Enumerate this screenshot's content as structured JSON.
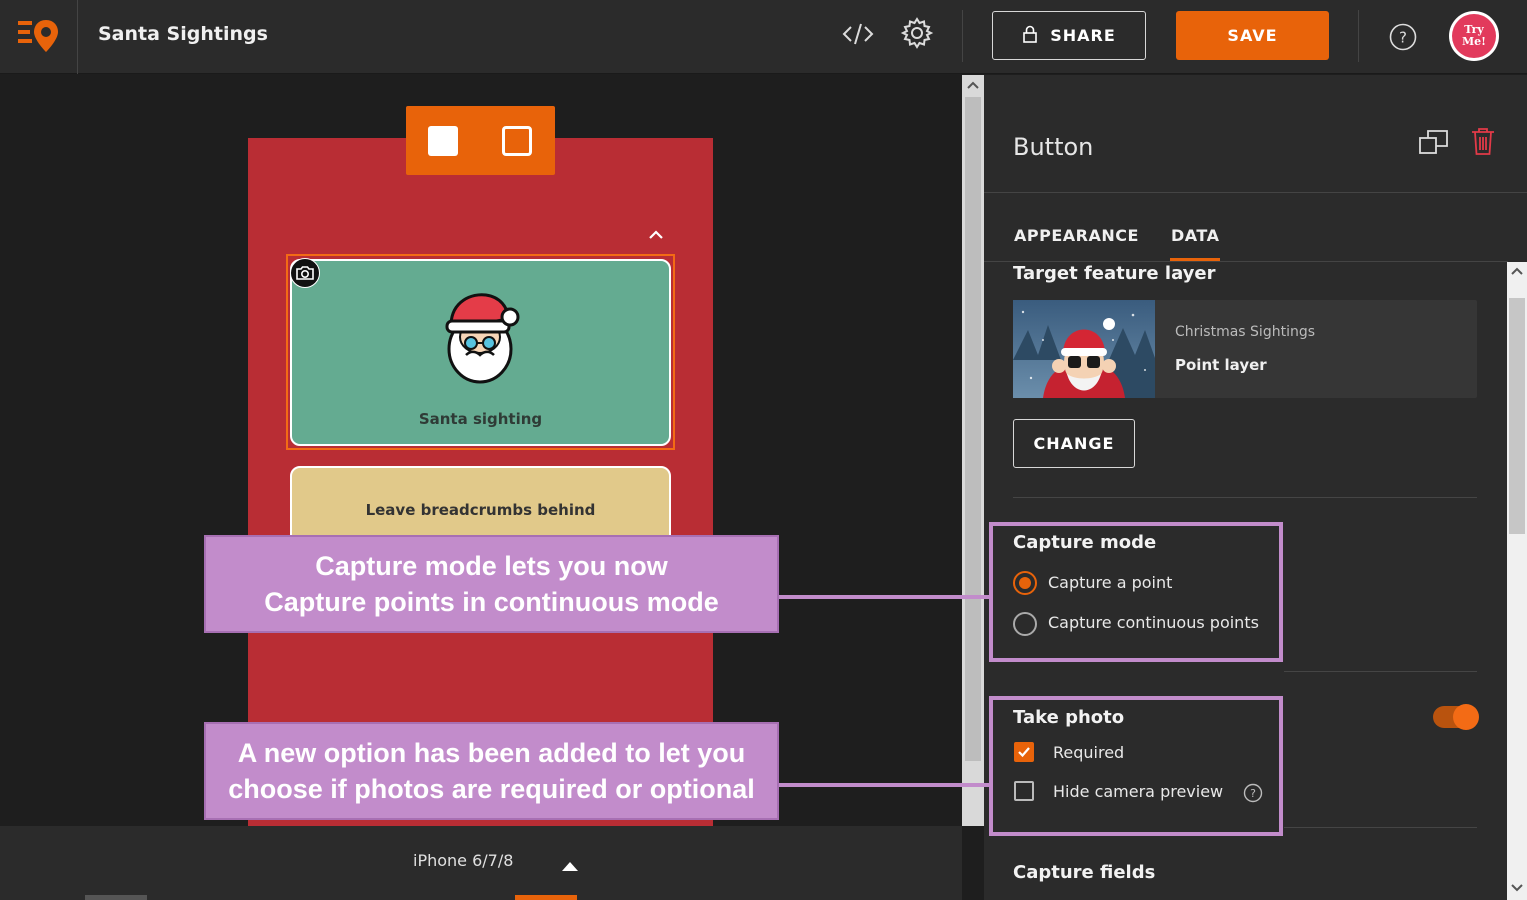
{
  "header": {
    "app_title": "Santa Sightings",
    "share_label": "SHARE",
    "save_label": "SAVE",
    "avatar_text_1": "Try",
    "avatar_text_2": "Me!"
  },
  "canvas": {
    "santa_card_label": "Santa sighting",
    "breadcrumbs_card_label": "Leave breadcrumbs behind",
    "device_label": "iPhone 6/7/8"
  },
  "panel": {
    "title": "Button",
    "tabs": [
      {
        "label": "APPEARANCE"
      },
      {
        "label": "DATA"
      }
    ],
    "target_layer_heading": "Target feature layer",
    "layer_name": "Christmas Sightings",
    "layer_type": "Point layer",
    "change_label": "CHANGE",
    "capture_mode_heading": "Capture mode",
    "capture_options": [
      {
        "label": "Capture a point",
        "selected": true
      },
      {
        "label": "Capture continuous points",
        "selected": false
      }
    ],
    "take_photo_heading": "Take photo",
    "take_photo_enabled": true,
    "photo_options": [
      {
        "label": "Required",
        "checked": true
      },
      {
        "label": "Hide camera preview",
        "checked": false
      }
    ],
    "capture_fields_heading": "Capture fields"
  },
  "callouts": {
    "capture_mode_line1": "Capture mode lets you now",
    "capture_mode_line2": "Capture points in continuous mode",
    "photo_line1": "A new option has been added to let you",
    "photo_line2": "choose if photos are required or optional"
  },
  "colors": {
    "accent": "#e8630a",
    "phone_bg": "#b92d34",
    "santa_card": "#64ab91",
    "breadcrumb_card": "#e1c98a",
    "callout": "#c28ccb"
  }
}
